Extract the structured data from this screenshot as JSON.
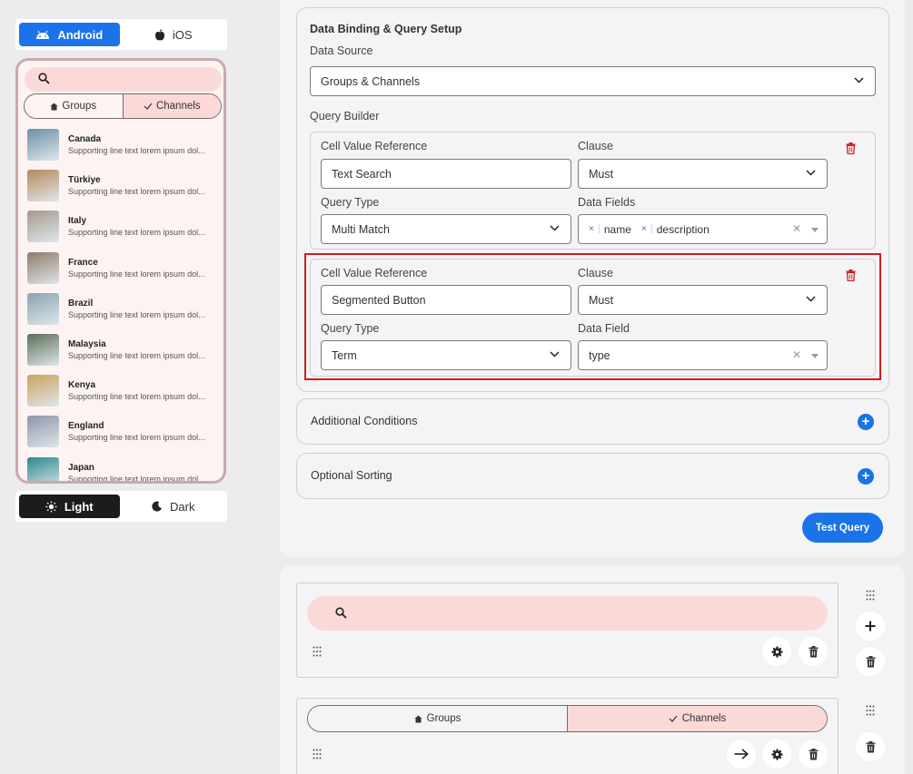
{
  "platform_toggle": {
    "android": "Android",
    "ios": "iOS"
  },
  "theme_toggle": {
    "light": "Light",
    "dark": "Dark"
  },
  "preview": {
    "segments": {
      "groups": "Groups",
      "channels": "Channels"
    },
    "items": [
      {
        "title": "Canada",
        "sub": "Supporting line text lorem ipsum dol...",
        "color": "#6b8fa8"
      },
      {
        "title": "Türkiye",
        "sub": "Supporting line text lorem ipsum dol...",
        "color": "#b58a5a"
      },
      {
        "title": "Italy",
        "sub": "Supporting line text lorem ipsum dol...",
        "color": "#a39a8c"
      },
      {
        "title": "France",
        "sub": "Supporting line text lorem ipsum dol...",
        "color": "#8c7b6a"
      },
      {
        "title": "Brazil",
        "sub": "Supporting line text lorem ipsum dol...",
        "color": "#8aa3b0"
      },
      {
        "title": "Malaysia",
        "sub": "Supporting line text lorem ipsum dol...",
        "color": "#5a6e58"
      },
      {
        "title": "Kenya",
        "sub": "Supporting line text lorem ipsum dol...",
        "color": "#c9a45c"
      },
      {
        "title": "England",
        "sub": "Supporting line text lorem ipsum dol...",
        "color": "#8f95a8"
      },
      {
        "title": "Japan",
        "sub": "Supporting line text lorem ipsum dol...",
        "color": "#2c8a8c"
      }
    ]
  },
  "binding": {
    "title": "Data Binding & Query Setup",
    "data_source_label": "Data Source",
    "data_source_value": "Groups & Channels",
    "query_builder_label": "Query Builder",
    "queries": [
      {
        "cell_ref_label": "Cell Value Reference",
        "cell_ref_value": "Text Search",
        "clause_label": "Clause",
        "clause_value": "Must",
        "query_type_label": "Query Type",
        "query_type_value": "Multi Match",
        "fields_label": "Data Fields",
        "fields": [
          "name",
          "description"
        ]
      },
      {
        "cell_ref_label": "Cell Value Reference",
        "cell_ref_value": "Segmented Button",
        "clause_label": "Clause",
        "clause_value": "Must",
        "query_type_label": "Query Type",
        "query_type_value": "Term",
        "fields_label": "Data Field",
        "field_value": "type"
      }
    ],
    "additional_conditions": "Additional Conditions",
    "optional_sorting": "Optional Sorting",
    "test_query": "Test Query"
  },
  "components": {
    "segments": {
      "groups": "Groups",
      "channels": "Channels"
    }
  },
  "colors": {
    "accent": "#1a73e8",
    "danger": "#d11b1b",
    "pink": "#fbd9d9"
  }
}
